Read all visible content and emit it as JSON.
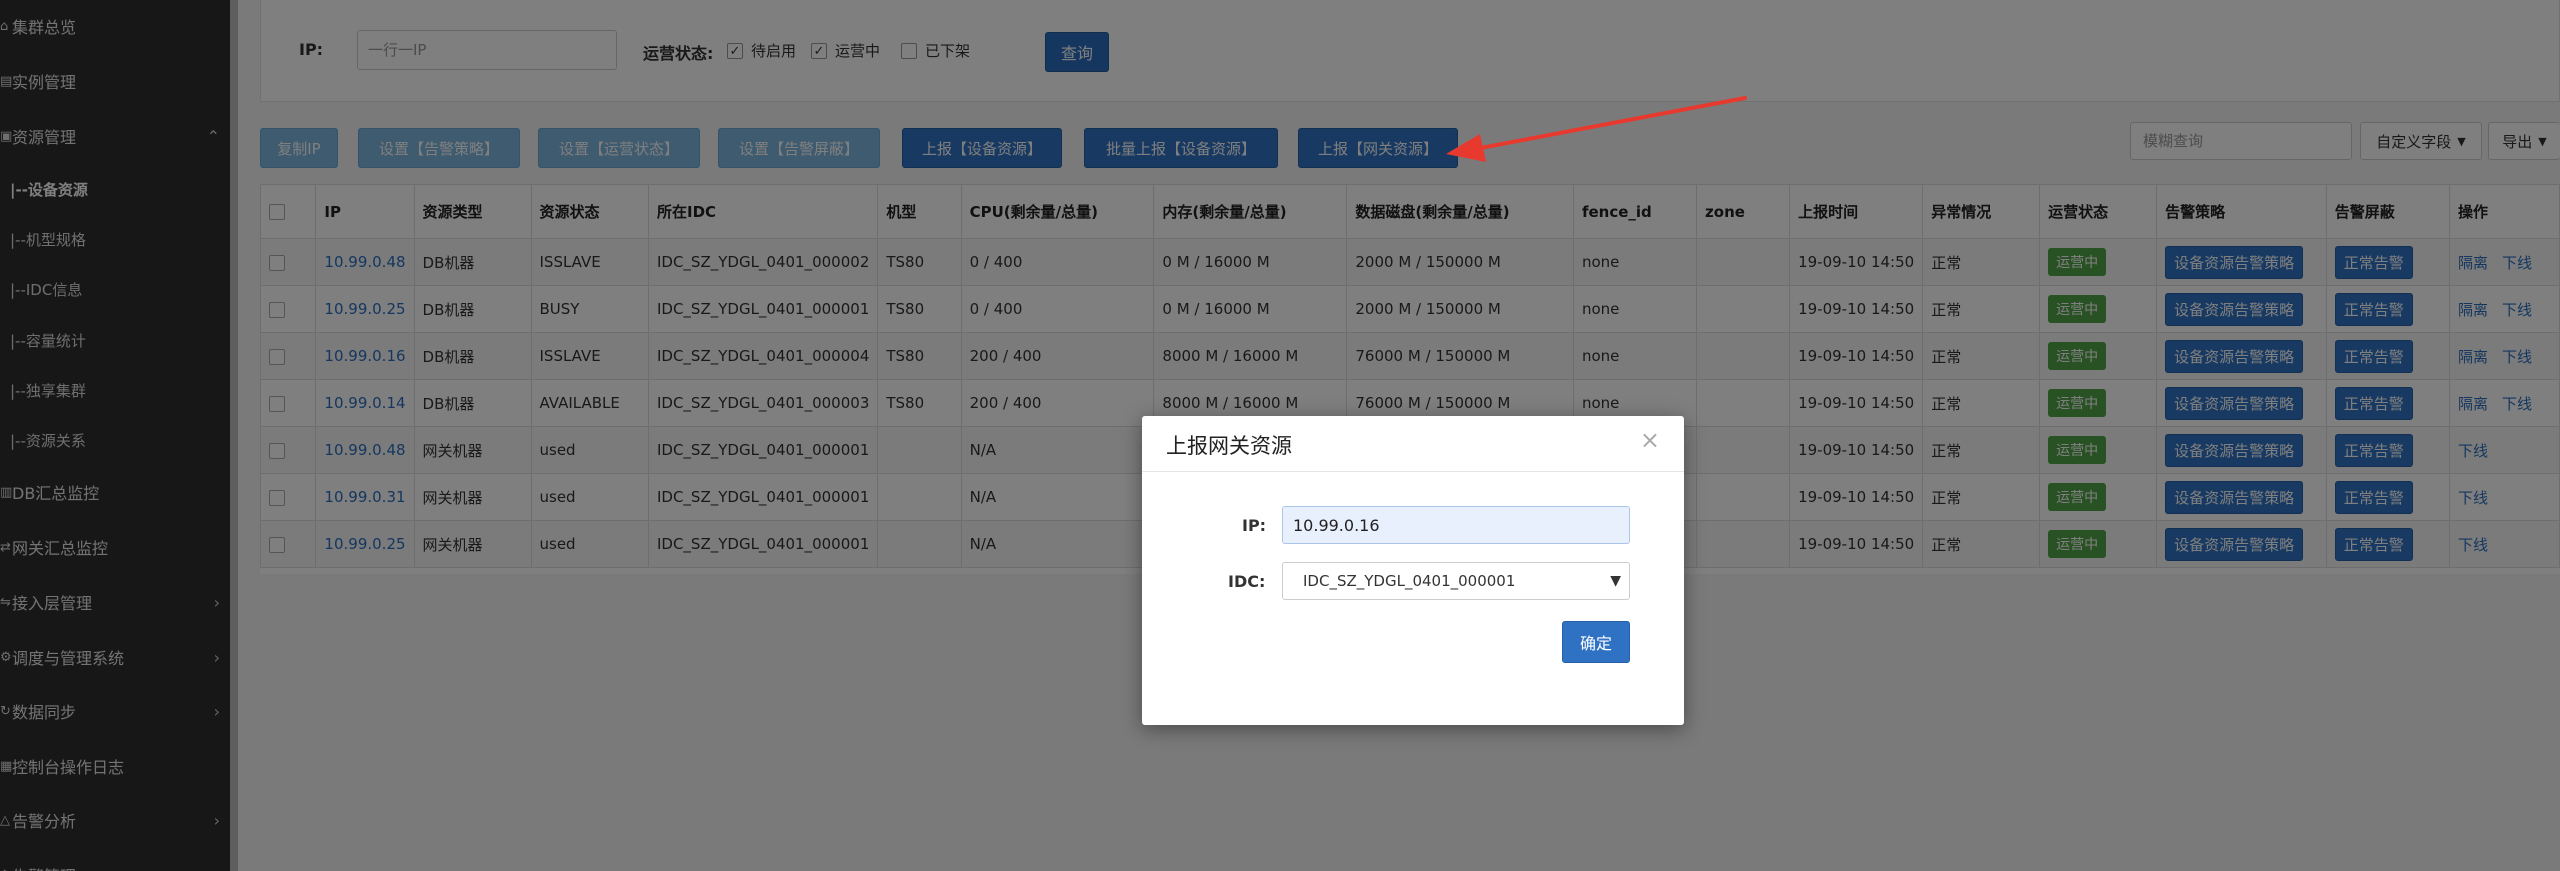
{
  "sidebar": {
    "items": [
      {
        "label": "集群总览",
        "icon": "home-icon",
        "chev": ""
      },
      {
        "label": "实例管理",
        "icon": "server-icon",
        "chev": ""
      },
      {
        "label": "资源管理",
        "icon": "box-icon",
        "chev": "^"
      },
      {
        "label": "|--设备资源",
        "icon": "",
        "chev": "",
        "sub": true,
        "active": true
      },
      {
        "label": "|--机型规格",
        "icon": "",
        "chev": "",
        "sub": true
      },
      {
        "label": "|--IDC信息",
        "icon": "",
        "chev": "",
        "sub": true
      },
      {
        "label": "|--容量统计",
        "icon": "",
        "chev": "",
        "sub": true
      },
      {
        "label": "|--独享集群",
        "icon": "",
        "chev": "",
        "sub": true
      },
      {
        "label": "|--资源关系",
        "icon": "",
        "chev": "",
        "sub": true
      },
      {
        "label": "DB汇总监控",
        "icon": "monitor-icon",
        "chev": ""
      },
      {
        "label": "网关汇总监控",
        "icon": "gateway-icon",
        "chev": ""
      },
      {
        "label": "接入层管理",
        "icon": "layers-icon",
        "chev": ">"
      },
      {
        "label": "调度与管理系统",
        "icon": "dispatch-icon",
        "chev": ">"
      },
      {
        "label": "数据同步",
        "icon": "sync-icon",
        "chev": ">"
      },
      {
        "label": "控制台操作日志",
        "icon": "log-icon",
        "chev": ""
      },
      {
        "label": "告警分析",
        "icon": "alert-icon",
        "chev": ">"
      },
      {
        "label": "告警管理",
        "icon": "bell-icon",
        "chev": ""
      }
    ]
  },
  "filter": {
    "ip_label": "IP:",
    "ip_placeholder": "一行一IP",
    "status_label": "运营状态:",
    "statuses": [
      {
        "label": "待启用",
        "checked": true
      },
      {
        "label": "运营中",
        "checked": true
      },
      {
        "label": "已下架",
        "checked": false
      }
    ],
    "query_label": "查询"
  },
  "toolbar": {
    "buttons": [
      {
        "label": "复制IP",
        "style": "light"
      },
      {
        "label": "设置【告警策略】",
        "style": "light"
      },
      {
        "label": "设置【运营状态】",
        "style": "light"
      },
      {
        "label": "设置【告警屏蔽】",
        "style": "light"
      },
      {
        "label": "上报【设备资源】",
        "style": "dark"
      },
      {
        "label": "批量上报【设备资源】",
        "style": "dark"
      },
      {
        "label": "上报【网关资源】",
        "style": "dark"
      }
    ],
    "search_placeholder": "模糊查询",
    "custom_fields_label": "自定义字段",
    "export_label": "导出"
  },
  "table": {
    "headers": [
      "IP",
      "资源类型",
      "资源状态",
      "所在IDC",
      "机型",
      "CPU(剩余量/总量)",
      "内存(剩余量/总量)",
      "数据磁盘(剩余量/总量)",
      "fence_id",
      "zone",
      "上报时间",
      "异常情况",
      "运营状态",
      "告警策略",
      "告警屏蔽",
      "操作"
    ],
    "rows": [
      {
        "ip": "10.99.0.48",
        "type": "DB机器",
        "state": "ISSLAVE",
        "idc": "IDC_SZ_YDGL_0401_000002",
        "model": "TS80",
        "cpu": "0 / 400",
        "mem": "0 M / 16000 M",
        "disk": "2000 M / 150000 M",
        "fence": "none",
        "zone": "",
        "time": "19-09-10 14:50",
        "abnormal": "正常",
        "op_state": "运营中",
        "policy": "设备资源告警策略",
        "mask": "正常告警",
        "ops": [
          "隔离",
          "下线"
        ]
      },
      {
        "ip": "10.99.0.25",
        "type": "DB机器",
        "state": "BUSY",
        "idc": "IDC_SZ_YDGL_0401_000001",
        "model": "TS80",
        "cpu": "0 / 400",
        "mem": "0 M / 16000 M",
        "disk": "2000 M / 150000 M",
        "fence": "none",
        "zone": "",
        "time": "19-09-10 14:50",
        "abnormal": "正常",
        "op_state": "运营中",
        "policy": "设备资源告警策略",
        "mask": "正常告警",
        "ops": [
          "隔离",
          "下线"
        ]
      },
      {
        "ip": "10.99.0.16",
        "type": "DB机器",
        "state": "ISSLAVE",
        "idc": "IDC_SZ_YDGL_0401_000004",
        "model": "TS80",
        "cpu": "200 / 400",
        "mem": "8000 M / 16000 M",
        "disk": "76000 M / 150000 M",
        "fence": "none",
        "zone": "",
        "time": "19-09-10 14:50",
        "abnormal": "正常",
        "op_state": "运营中",
        "policy": "设备资源告警策略",
        "mask": "正常告警",
        "ops": [
          "隔离",
          "下线"
        ]
      },
      {
        "ip": "10.99.0.14",
        "type": "DB机器",
        "state": "AVAILABLE",
        "idc": "IDC_SZ_YDGL_0401_000003",
        "model": "TS80",
        "cpu": "200 / 400",
        "mem": "8000 M / 16000 M",
        "disk": "76000 M / 150000 M",
        "fence": "none",
        "zone": "",
        "time": "19-09-10 14:50",
        "abnormal": "正常",
        "op_state": "运营中",
        "policy": "设备资源告警策略",
        "mask": "正常告警",
        "ops": [
          "隔离",
          "下线"
        ]
      },
      {
        "ip": "10.99.0.48",
        "type": "网关机器",
        "state": "used",
        "idc": "IDC_SZ_YDGL_0401_000001",
        "model": "",
        "cpu": "N/A",
        "mem": "",
        "disk": "",
        "fence": "",
        "zone": "",
        "time": "19-09-10 14:50",
        "abnormal": "正常",
        "op_state": "运营中",
        "policy": "设备资源告警策略",
        "mask": "正常告警",
        "ops": [
          "下线"
        ]
      },
      {
        "ip": "10.99.0.31",
        "type": "网关机器",
        "state": "used",
        "idc": "IDC_SZ_YDGL_0401_000001",
        "model": "",
        "cpu": "N/A",
        "mem": "",
        "disk": "",
        "fence": "",
        "zone": "",
        "time": "19-09-10 14:50",
        "abnormal": "正常",
        "op_state": "运营中",
        "policy": "设备资源告警策略",
        "mask": "正常告警",
        "ops": [
          "下线"
        ]
      },
      {
        "ip": "10.99.0.25",
        "type": "网关机器",
        "state": "used",
        "idc": "IDC_SZ_YDGL_0401_000001",
        "model": "",
        "cpu": "N/A",
        "mem": "",
        "disk": "",
        "fence": "",
        "zone": "",
        "time": "19-09-10 14:50",
        "abnormal": "正常",
        "op_state": "运营中",
        "policy": "设备资源告警策略",
        "mask": "正常告警",
        "ops": [
          "下线"
        ]
      }
    ]
  },
  "modal": {
    "title": "上报网关资源",
    "ip_label": "IP:",
    "ip_value": "10.99.0.16",
    "idc_label": "IDC:",
    "idc_value": "IDC_SZ_YDGL_0401_000001",
    "ok_label": "确定"
  },
  "colors": {
    "primary": "#2f72c4",
    "primary_light": "#7fb6de",
    "success": "#52a548",
    "sidebar_bg": "#2f2f2f",
    "annotation_arrow": "#e8392f"
  }
}
